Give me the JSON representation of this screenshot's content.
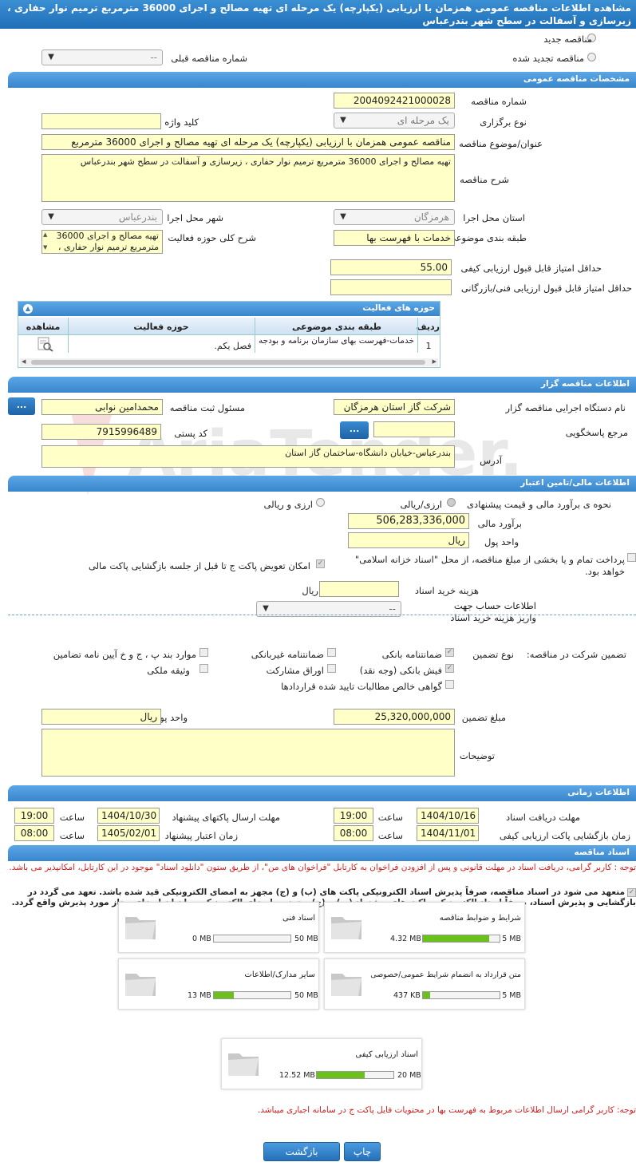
{
  "page_title": "مشاهده اطلاعات مناقصه عمومی همزمان با ارزیابی (یکپارچه) یک مرحله ای تهیه مصالح و اجرای 36000 مترمربع ترمیم نوار حفاری ، زیرسازی و آسفالت در سطح شهر بندرعباس",
  "top": {
    "new_tender": "مناقصه جدید",
    "renewed_tender": "مناقصه تجدید شده",
    "previous_number_label": "شماره مناقصه قبلی",
    "previous_number_value": "--"
  },
  "general": {
    "header": "مشخصات مناقصه عمومی",
    "number_label": "شماره مناقصه",
    "number_value": "2004092421000028",
    "type_label": "نوع برگزاری",
    "type_value": "یک مرحله ای",
    "keyword_label": "کلید واژه",
    "keyword_value": "",
    "subject_label": "عنوان/موضوع مناقصه",
    "subject_value": "مناقصه عمومی همزمان با ارزیابی (یکپارچه) یک مرحله ای تهیه مصالح و اجرای 36000 مترمربع",
    "desc_label": "شرح مناقصه",
    "desc_value": "تهیه مصالح و اجرای 36000 مترمربع ترمیم نوار حفاری ، زیرسازی و آسفالت در سطح شهر بندرعباس",
    "province_label": "استان محل اجرا",
    "province_value": "هرمزگان",
    "city_label": "شهر محل اجرا",
    "city_value": "بندرعباس",
    "category_label": "طبقه بندی موضوعی",
    "category_value": "خدمات با فهرست بها",
    "scope_label": "شرح کلی حوزه فعالیت",
    "scope_value": "تهیه مصالح و اجرای 36000 مترمربع ترمیم نوار حفاری ،",
    "min_quality_label": "حداقل امتیاز قابل قبول ارزیابی کیفی",
    "min_quality_value": "55.00",
    "min_tech_label": "حداقل امتیاز قابل قبول ارزیابی فنی/بازرگانی",
    "min_tech_value": ""
  },
  "activity_table": {
    "title": "حوزه های فعالیت",
    "columns": [
      "ردیف",
      "طبقه بندی موضوعی",
      "حوزه فعالیت",
      "مشاهده"
    ],
    "rows": [
      {
        "row": "1",
        "category": "خدمات-فهرست بهای سازمان برنامه و بودجه",
        "area": "فصل یکم."
      }
    ]
  },
  "organizer": {
    "header": "اطلاعات مناقصه گزار",
    "org_label": "نام دستگاه اجرایی مناقصه گزار",
    "org_value": "شرکت گاز استان هرمزگان",
    "responsible_label": "مسئول ثبت مناقصه",
    "responsible_value": "محمدامین نوابی",
    "reference_label": "مرجع پاسخگویی",
    "reference_value": "",
    "postal_label": "کد پستی",
    "postal_value": "7915996489",
    "address_label": "آدرس",
    "address_value": "بندرعباس-خیابان دانشگاه-ساختمان گاز استان",
    "dots": "..."
  },
  "finance": {
    "header": "اطلاعات مالی/تامین اعتبار",
    "estimate_method_label": "نحوه ی برآورد مالی و قیمت پیشنهادی",
    "rial_fx": "ارزی/ریالی",
    "fx_and_rial": "ارزی و ریالی",
    "estimate_label": "برآورد مالی",
    "estimate_value": "506,283,336,000",
    "currency_label": "واحد پول",
    "currency_value": "ریال",
    "payment_text": "پرداخت تمام و یا بخشی از مبلغ مناقصه، از محل \"اسناد خزانه اسلامی\" خواهد بود.",
    "swap_text": "امکان تعویض پاکت ج تا قبل از جلسه بازگشایی پاکت مالی",
    "doc_cost_label": "هزینه خرید اسناد",
    "doc_cost_unit": "ریال",
    "account_label": "اطلاعات حساب جهت واریز هزینه خرید اسناد",
    "account_value": "--"
  },
  "guarantee": {
    "title": "تضمین شرکت در مناقصه:",
    "type_label": "نوع تضمین",
    "opt_bank": "ضمانتنامه بانکی",
    "opt_nonbank": "ضمانتنامه غیربانکی",
    "opt_articles": "موارد بند پ ، ج و خ آیین نامه تضامین",
    "opt_cash": "فیش بانکی (وجه نقد)",
    "opt_bonds": "اوراق مشارکت",
    "opt_property": "وثیقه ملکی",
    "opt_claims": "گواهی خالص مطالبات تایید شده قراردادها",
    "amount_label": "مبلغ تضمین",
    "amount_value": "25,320,000,000",
    "currency_label": "واحد پول",
    "currency_value": "ریال",
    "notes_label": "توضیحات"
  },
  "timing": {
    "header": "اطلاعات زمانی",
    "receive_label": "مهلت دریافت اسناد",
    "receive_date": "1404/10/16",
    "receive_time": "19:00",
    "send_label": "مهلت ارسال پاکتهای پیشنهاد",
    "send_date": "1404/10/30",
    "send_time": "19:00",
    "open_label": "زمان بازگشایی پاکت ارزیابی کیفی",
    "open_date": "1404/11/01",
    "open_time": "08:00",
    "valid_label": "زمان اعتبار پیشنهاد",
    "valid_date": "1405/02/01",
    "valid_time": "08:00",
    "time_label": "ساعت"
  },
  "documents": {
    "header": "اسناد مناقصه",
    "note1": "توجه : کاربر گرامی، دریافت اسناد در مهلت قانونی و پس از افزودن فراخوان به کارتابل \"فراخوان های من\"، از طریق ستون \"دانلود اسناد\" موجود در این کارتابل، امکانپذیر می باشد.",
    "commit": "متعهد می شود در اسناد مناقصه، صرفاً پذیرش اسناد الکترونیکی پاکت های (ب) و (ج) مجهز به امضای الکترونیکی قید شده باشد. تعهد می گردد در بازگشایی و پذیرش اسناد، صرفاً اسناد الکترونیکی پاکت های پیشنهاد (ب) و (ج) مجهز به امضای الکترونیکی صاحبان امضای مجاز مورد پذیرش واقع گردد.",
    "cards": [
      {
        "title": "شرایط و ضوابط مناقصه",
        "max": "5 MB",
        "used": "4.32 MB",
        "fill": 0.86
      },
      {
        "title": "اسناد فنی",
        "max": "50 MB",
        "used": "0 MB",
        "fill": 0.0
      },
      {
        "title": "متن قرارداد به انضمام شرایط عمومی/خصوصی",
        "max": "5 MB",
        "used": "437 KB",
        "fill": 0.09
      },
      {
        "title": "سایر مدارک/اطلاعات",
        "max": "50 MB",
        "used": "13 MB",
        "fill": 0.26
      },
      {
        "title": "اسناد ارزیابی کیفی",
        "max": "20 MB",
        "used": "12.52 MB",
        "fill": 0.63
      }
    ],
    "note2": "توجه: کاربر گرامی ارسال اطلاعات مربوط به فهرست بها در محتویات فایل پاکت ج در سامانه اجباری میباشد."
  },
  "buttons": {
    "back": "بازگشت",
    "print": "چاپ"
  },
  "watermark": "AriaTender.net"
}
